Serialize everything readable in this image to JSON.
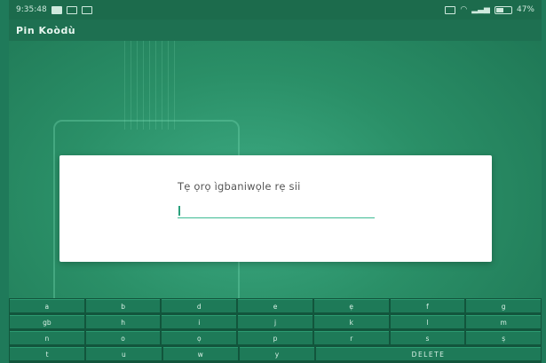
{
  "status_bar": {
    "time": "9:35:48",
    "battery": "47%"
  },
  "app_bar": {
    "title": "Pin Koòdù"
  },
  "dialog": {
    "prompt": "Tẹ ọrọ ìgbaniwọle rẹ sii",
    "pin_value": ""
  },
  "keyboard": {
    "row1": [
      "a",
      "b",
      "d",
      "e",
      "ẹ",
      "f",
      "g"
    ],
    "row2": [
      "gb",
      "h",
      "i",
      "j",
      "k",
      "l",
      "m"
    ],
    "row3": [
      "n",
      "o",
      "ọ",
      "p",
      "r",
      "s",
      "ṣ"
    ],
    "row4": [
      "t",
      "u",
      "w",
      "y"
    ],
    "delete_label": "DELETE"
  }
}
